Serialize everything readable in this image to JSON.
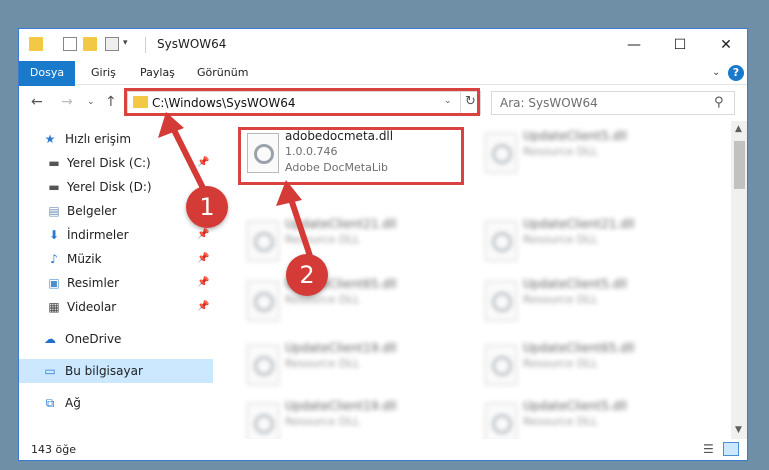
{
  "window": {
    "title": "SysWOW64",
    "controls": {
      "minimize": "—",
      "maximize": "☐",
      "close": "✕"
    }
  },
  "ribbon": {
    "tabs": [
      "Dosya",
      "Giriş",
      "Paylaş",
      "Görünüm"
    ],
    "help": "?"
  },
  "address": {
    "path": "C:\\Windows\\SysWOW64",
    "search_placeholder": "Ara: SysWOW64"
  },
  "sidebar": {
    "items": [
      {
        "label": "Hızlı erişim",
        "icon": "star-icon",
        "pinned": false
      },
      {
        "label": "Yerel Disk (C:)",
        "icon": "drive-icon",
        "pinned": true
      },
      {
        "label": "Yerel Disk (D:)",
        "icon": "drive-icon",
        "pinned": false
      },
      {
        "label": "Belgeler",
        "icon": "documents-icon",
        "pinned": true
      },
      {
        "label": "İndirmeler",
        "icon": "downloads-icon",
        "pinned": true
      },
      {
        "label": "Müzik",
        "icon": "music-icon",
        "pinned": true
      },
      {
        "label": "Resimler",
        "icon": "pictures-icon",
        "pinned": true
      },
      {
        "label": "Videolar",
        "icon": "videos-icon",
        "pinned": true
      },
      {
        "label": "OneDrive",
        "icon": "cloud-icon",
        "pinned": false
      },
      {
        "label": "Bu bilgisayar",
        "icon": "computer-icon",
        "pinned": false,
        "selected": true
      },
      {
        "label": "Ağ",
        "icon": "network-icon",
        "pinned": false
      }
    ]
  },
  "files": [
    {
      "name": "adobedocmeta.dll",
      "version": "1.0.0.746",
      "description": "Adobe DocMetaLib",
      "highlighted": true
    },
    {
      "name": "UpdateClient5.dll",
      "description": "Resource DLL"
    },
    {
      "name": "UpdateClient21.dll",
      "description": "Resource DLL"
    },
    {
      "name": "UpdateClient21.dll",
      "description": "Resource DLL"
    },
    {
      "name": "UpdateClient65.dll",
      "description": "Resource DLL"
    },
    {
      "name": "UpdateClient5.dll",
      "description": "Resource DLL"
    },
    {
      "name": "UpdateClient19.dll",
      "description": "Resource DLL"
    },
    {
      "name": "UpdateClient65.dll",
      "description": "Resource DLL"
    },
    {
      "name": "UpdateClient19.dll",
      "description": "Resource DLL"
    },
    {
      "name": "UpdateClient5.dll",
      "description": "Resource DLL"
    }
  ],
  "status": {
    "item_count": "143 öğe"
  },
  "annotations": {
    "badge1": "1",
    "badge2": "2",
    "color": "#d43a36"
  }
}
